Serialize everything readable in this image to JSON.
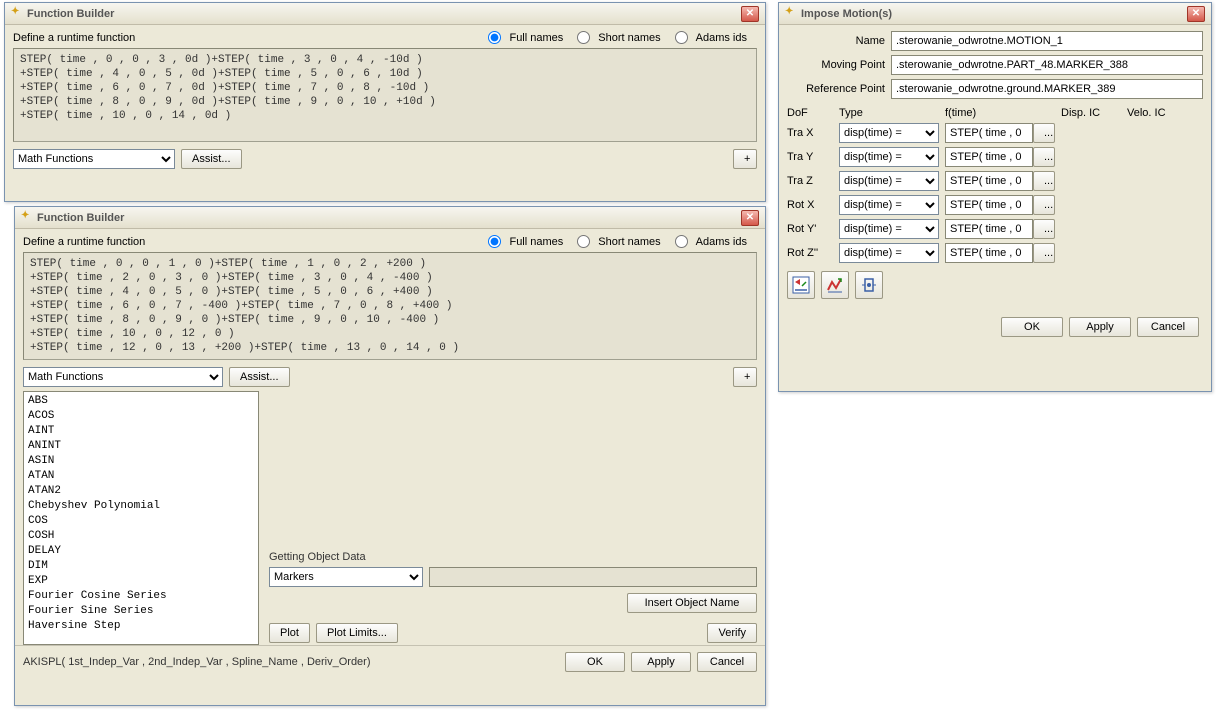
{
  "fb1": {
    "title": "Function Builder",
    "define_label": "Define a runtime function",
    "radio_full": "Full names",
    "radio_short": "Short names",
    "radio_adams": "Adams ids",
    "code": "STEP( time , 0 , 0 , 3 , 0d )+STEP( time , 3 , 0 , 4 , -10d )\n+STEP( time , 4 , 0 , 5 , 0d )+STEP( time , 5 , 0 , 6 , 10d )\n+STEP( time , 6 , 0 , 7 , 0d )+STEP( time , 7 , 0 , 8 , -10d )\n+STEP( time , 8 , 0 , 9 , 0d )+STEP( time , 9 , 0 , 10 , +10d )\n+STEP( time , 10 , 0 , 14 , 0d )",
    "math_functions": "Math Functions",
    "assist": "Assist...",
    "plus": "+"
  },
  "fb2": {
    "title": "Function Builder",
    "define_label": "Define a runtime function",
    "radio_full": "Full names",
    "radio_short": "Short names",
    "radio_adams": "Adams ids",
    "code": "STEP( time , 0 , 0 , 1 , 0 )+STEP( time , 1 , 0 , 2 , +200 )\n+STEP( time , 2 , 0 , 3 , 0 )+STEP( time , 3 , 0 , 4 , -400 )\n+STEP( time , 4 , 0 , 5 , 0 )+STEP( time , 5 , 0 , 6 , +400 )\n+STEP( time , 6 , 0 , 7 , -400 )+STEP( time , 7 , 0 , 8 , +400 )\n+STEP( time , 8 , 0 , 9 , 0 )+STEP( time , 9 , 0 , 10 , -400 )\n+STEP( time , 10 , 0 , 12 , 0 )\n+STEP( time , 12 , 0 , 13 , +200 )+STEP( time , 13 , 0 , 14 , 0 )",
    "math_functions": "Math Functions",
    "assist": "Assist...",
    "plus": "+",
    "functions_list": [
      "ABS",
      "ACOS",
      "AINT",
      "ANINT",
      "ASIN",
      "ATAN",
      "ATAN2",
      "Chebyshev Polynomial",
      "COS",
      "COSH",
      "DELAY",
      "DIM",
      "EXP",
      "Fourier Cosine Series",
      "Fourier Sine Series",
      "Haversine Step"
    ],
    "getting_object_data": "Getting Object Data",
    "markers": "Markers",
    "insert_object_name": "Insert Object Name",
    "plot": "Plot",
    "plot_limits": "Plot Limits...",
    "verify": "Verify",
    "status": "AKISPL( 1st_Indep_Var , 2nd_Indep_Var , Spline_Name , Deriv_Order)",
    "ok": "OK",
    "apply": "Apply",
    "cancel": "Cancel"
  },
  "im": {
    "title": "Impose Motion(s)",
    "name_label": "Name",
    "name_value": ".sterowanie_odwrotne.MOTION_1",
    "moving_point_label": "Moving Point",
    "moving_point_value": ".sterowanie_odwrotne.PART_48.MARKER_388",
    "reference_point_label": "Reference Point",
    "reference_point_value": ".sterowanie_odwrotne.ground.MARKER_389",
    "col_dof": "DoF",
    "col_type": "Type",
    "col_ft": "f(time)",
    "col_disp": "Disp. IC",
    "col_velo": "Velo. IC",
    "rows": [
      {
        "dof": "Tra X",
        "type": "disp(time) =",
        "ft": "STEP( time , 0"
      },
      {
        "dof": "Tra Y",
        "type": "disp(time) =",
        "ft": "STEP( time , 0"
      },
      {
        "dof": "Tra Z",
        "type": "disp(time) =",
        "ft": "STEP( time , 0"
      },
      {
        "dof": "Rot X",
        "type": "disp(time) =",
        "ft": "STEP( time , 0"
      },
      {
        "dof": "Rot Y'",
        "type": "disp(time) =",
        "ft": "STEP( time , 0"
      },
      {
        "dof": "Rot Z''",
        "type": "disp(time) =",
        "ft": "STEP( time , 0"
      }
    ],
    "ellipsis": "...",
    "ok": "OK",
    "apply": "Apply",
    "cancel": "Cancel"
  }
}
